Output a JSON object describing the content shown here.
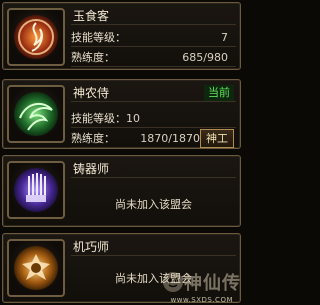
{
  "cards": [
    {
      "name": "玉食客",
      "icon": "flame-ring-icon",
      "rows": [
        {
          "label": "技能等级：",
          "value": "7"
        },
        {
          "label": "熟练度：",
          "value": "685/980"
        }
      ]
    },
    {
      "name": "神农侍",
      "icon": "green-leaf-swirl-icon",
      "status": "当前",
      "rows": [
        {
          "label": "技能等级：",
          "value": "10"
        },
        {
          "label": "熟练度：",
          "value": "1870/1870"
        }
      ],
      "button": "神工"
    },
    {
      "name": "铸器师",
      "icon": "purple-forge-icon",
      "message": "尚未加入该盟会"
    },
    {
      "name": "机巧师",
      "icon": "gear-puzzle-icon",
      "message": "尚未加入该盟会"
    }
  ],
  "watermark": {
    "text": "神仙传",
    "url": "www.SXDS.COM"
  },
  "colors": {
    "border": "#6b5a3e",
    "status_green": "#5be35b",
    "button_border": "#b08c4f"
  }
}
